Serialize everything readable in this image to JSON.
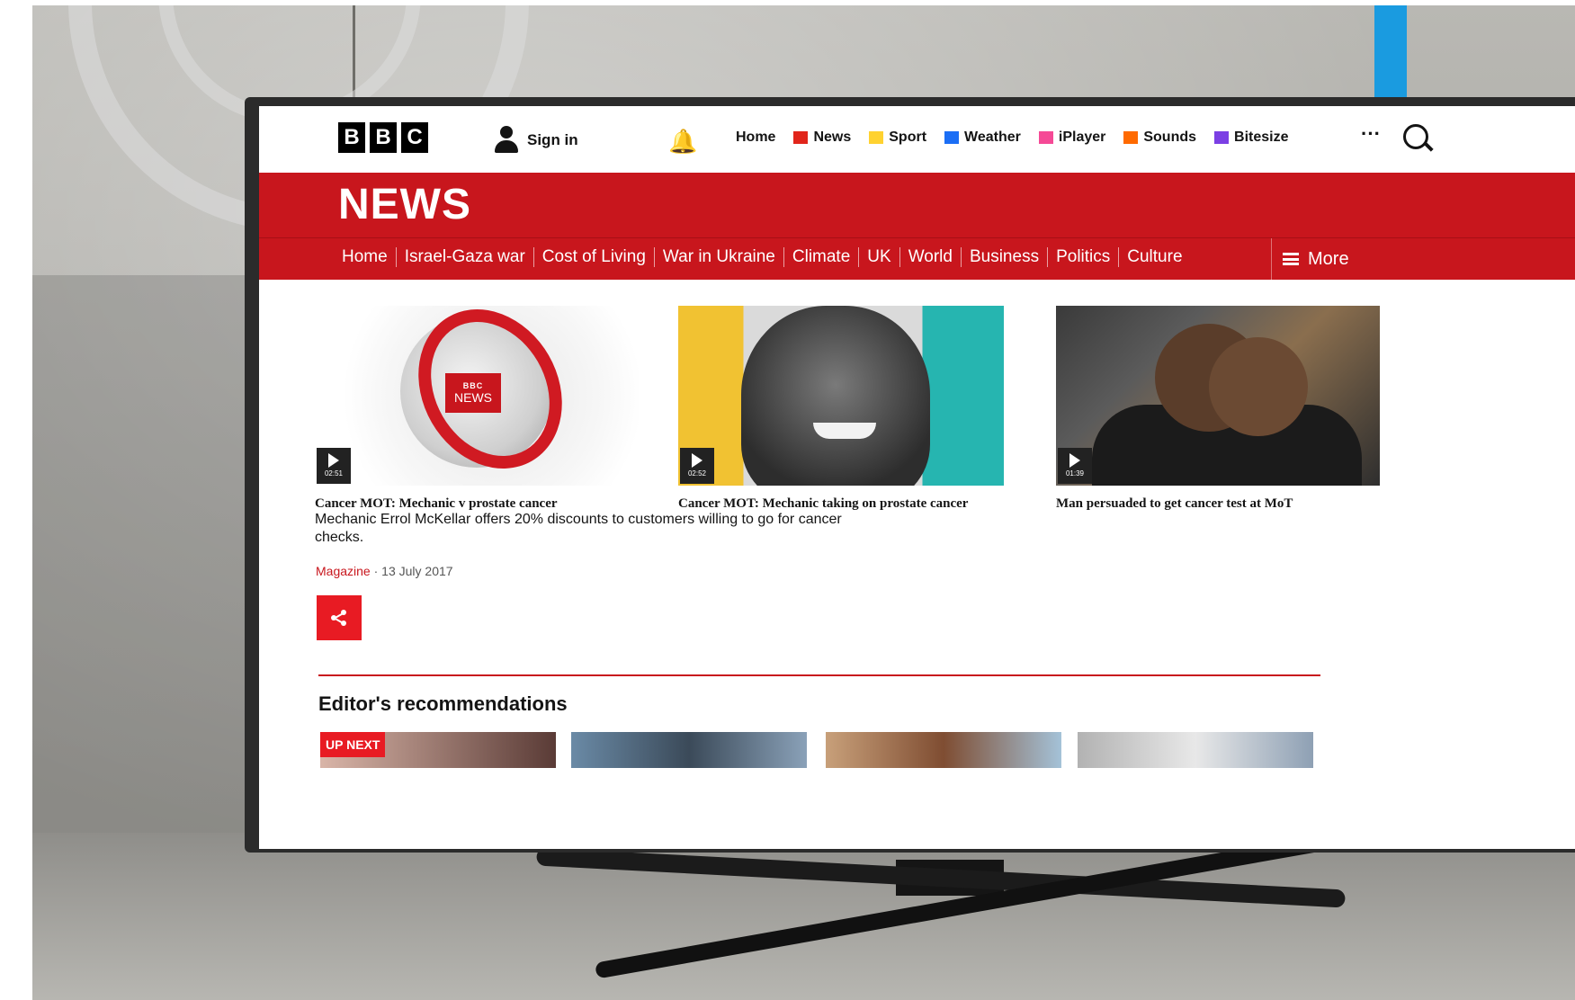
{
  "top_nav": {
    "logo_letters": [
      "B",
      "B",
      "C"
    ],
    "sign_in": "Sign in",
    "items": [
      {
        "label": "Home",
        "color": ""
      },
      {
        "label": "News",
        "color": "#e1251b"
      },
      {
        "label": "Sport",
        "color": "#ffd230"
      },
      {
        "label": "Weather",
        "color": "#1b6ef5"
      },
      {
        "label": "iPlayer",
        "color": "#f54996"
      },
      {
        "label": "Sounds",
        "color": "#ff6a00"
      },
      {
        "label": "Bitesize",
        "color": "#7b3fe4"
      }
    ],
    "more_dots": "···"
  },
  "news_header": {
    "title": "NEWS"
  },
  "sub_nav": {
    "items": [
      "Home",
      "Israel-Gaza war",
      "Cost of Living",
      "War in Ukraine",
      "Climate",
      "UK",
      "World",
      "Business",
      "Politics",
      "Culture"
    ],
    "more": "More"
  },
  "videos": [
    {
      "caption": "Cancer MOT: Mechanic v prostate cancer",
      "duration": "02:51"
    },
    {
      "caption": "Cancer MOT: Mechanic taking on prostate cancer",
      "duration": "02:52"
    },
    {
      "caption": "Man persuaded to get cancer test at MoT",
      "duration": "01:39"
    }
  ],
  "thumb_badge": {
    "top": "BBC",
    "bottom": "NEWS"
  },
  "article": {
    "summary": "Mechanic Errol McKellar offers 20% discounts to customers willing to go for cancer checks.",
    "category": "Magazine",
    "separator": "·",
    "date": "13 July 2017"
  },
  "editors": {
    "heading": "Editor's recommendations",
    "up_next": "UP NEXT"
  },
  "colors": {
    "bbc_red": "#c8161d",
    "share_red": "#e81b23"
  }
}
